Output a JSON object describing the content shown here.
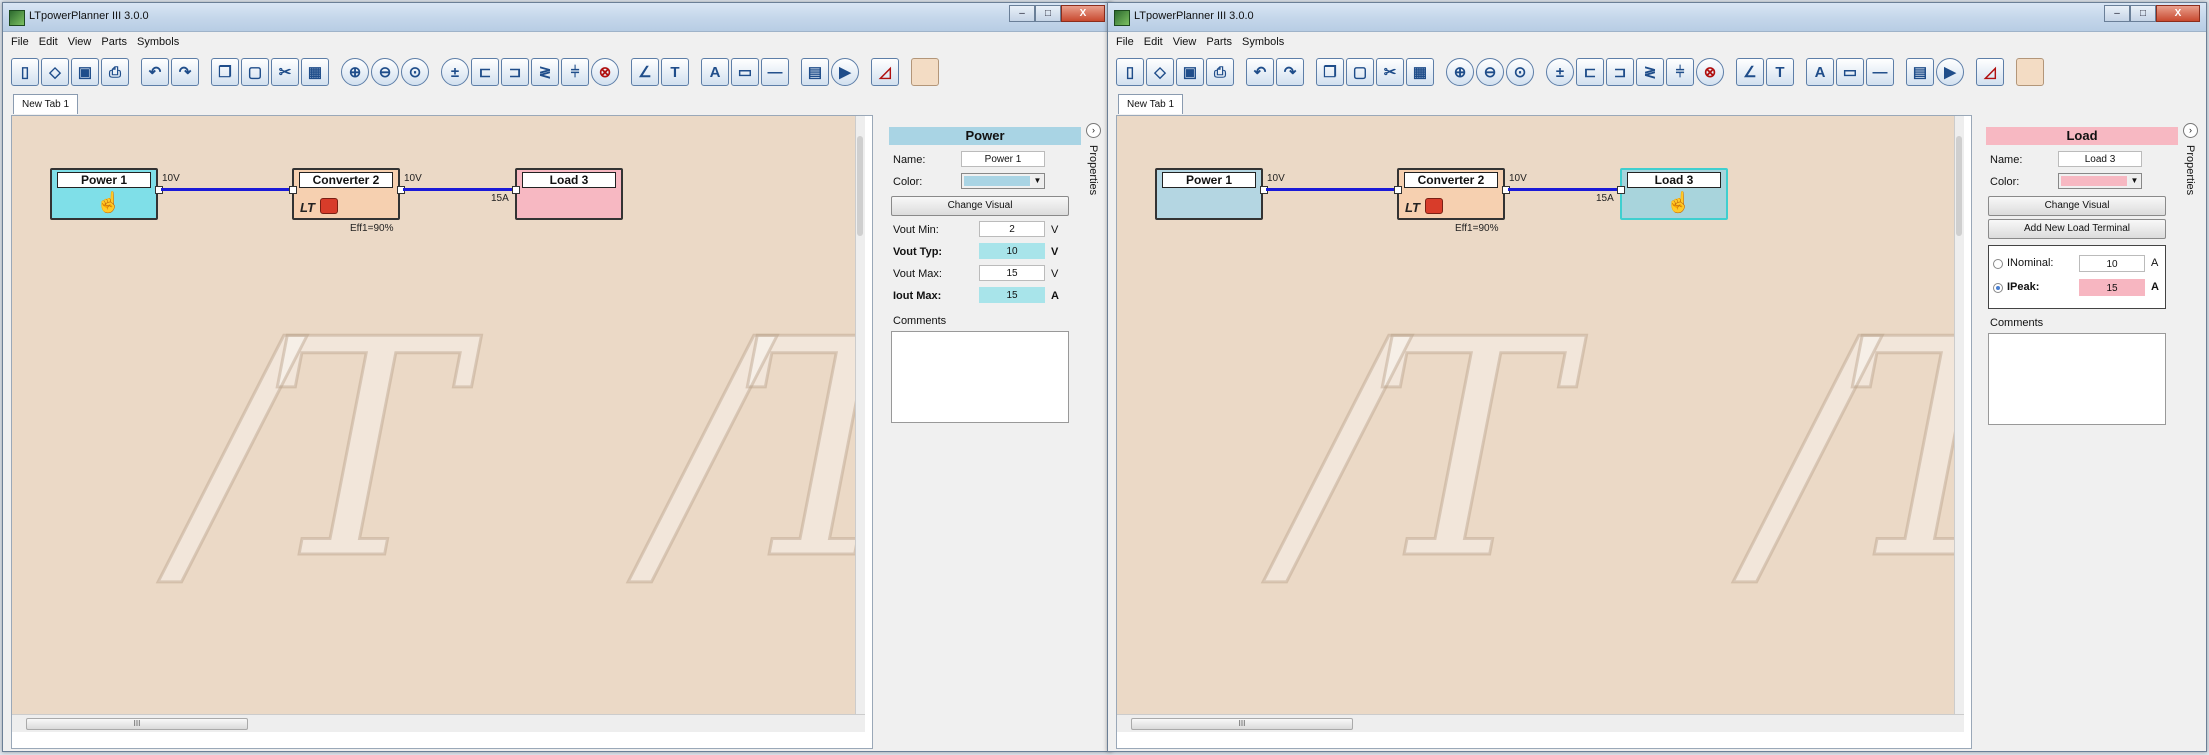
{
  "app": {
    "title": "LTpowerPlanner III 3.0.0",
    "window_controls": {
      "minimize": "–",
      "maximize": "□",
      "close": "X"
    },
    "menu": [
      "File",
      "Edit",
      "View",
      "Parts",
      "Symbols"
    ],
    "tab": "New Tab 1",
    "side_tab": "Properties",
    "side_collapse": "›",
    "scroll_grip": "III"
  },
  "left": {
    "blocks": {
      "power": {
        "label": "Power 1",
        "color": "#7fdfe8"
      },
      "converter": {
        "label": "Converter 2",
        "color": "#f6d0b0",
        "eff": "Eff1=90%"
      },
      "load": {
        "label": "Load 3",
        "color": "#f7b8c2"
      }
    },
    "net_labels": {
      "power_out": "10V",
      "conv_out": "10V",
      "load_in": "15A"
    },
    "props": {
      "header": "Power",
      "header_color": "#a9d4e4",
      "name_label": "Name:",
      "name_value": "Power 1",
      "color_label": "Color:",
      "color_value": "#a9d4e4",
      "change_visual": "Change Visual",
      "rows": [
        {
          "label": "Vout Min:",
          "value": "2",
          "unit": "V"
        },
        {
          "label": "Vout Typ:",
          "value": "10",
          "unit": "V"
        },
        {
          "label": "Vout Max:",
          "value": "15",
          "unit": "V"
        },
        {
          "label": "Iout Max:",
          "value": "15",
          "unit": "A"
        }
      ],
      "comments": "Comments"
    }
  },
  "right": {
    "blocks": {
      "power": {
        "label": "Power 1",
        "color": "#b4d6e2"
      },
      "converter": {
        "label": "Converter 2",
        "color": "#f6d0b0",
        "eff": "Eff1=90%"
      },
      "load": {
        "label": "Load 3",
        "color": "#a8d4dc"
      }
    },
    "net_labels": {
      "power_out": "10V",
      "conv_out": "10V",
      "load_in": "15A"
    },
    "props": {
      "header": "Load",
      "header_color": "#f7b8c2",
      "name_label": "Name:",
      "name_value": "Load 3",
      "color_label": "Color:",
      "color_value": "#f7b8c2",
      "change_visual": "Change Visual",
      "add_terminal": "Add New Load Terminal",
      "inominal_label": "INominal:",
      "inominal_value": "10",
      "inominal_unit": "A",
      "ipeak_label": "IPeak:",
      "ipeak_value": "15",
      "ipeak_unit": "A",
      "comments": "Comments"
    }
  },
  "toolbar_icons": [
    "new-document-icon",
    "open-icon",
    "save-icon",
    "print-icon",
    "undo-icon",
    "redo-icon",
    "copy-icon",
    "paste-icon",
    "cut-icon",
    "image-icon",
    "zoom-in-icon",
    "zoom-out-icon",
    "zoom-fit-icon",
    "power-source-icon",
    "converter-icon",
    "ldo-icon",
    "resistor-icon",
    "capacitor-icon",
    "load-icon",
    "line-icon",
    "text-icon",
    "text-A-icon",
    "rectangle-icon",
    "hline-icon",
    "report-icon",
    "run-icon",
    "lt-logo-icon",
    "color-swatch-icon"
  ]
}
